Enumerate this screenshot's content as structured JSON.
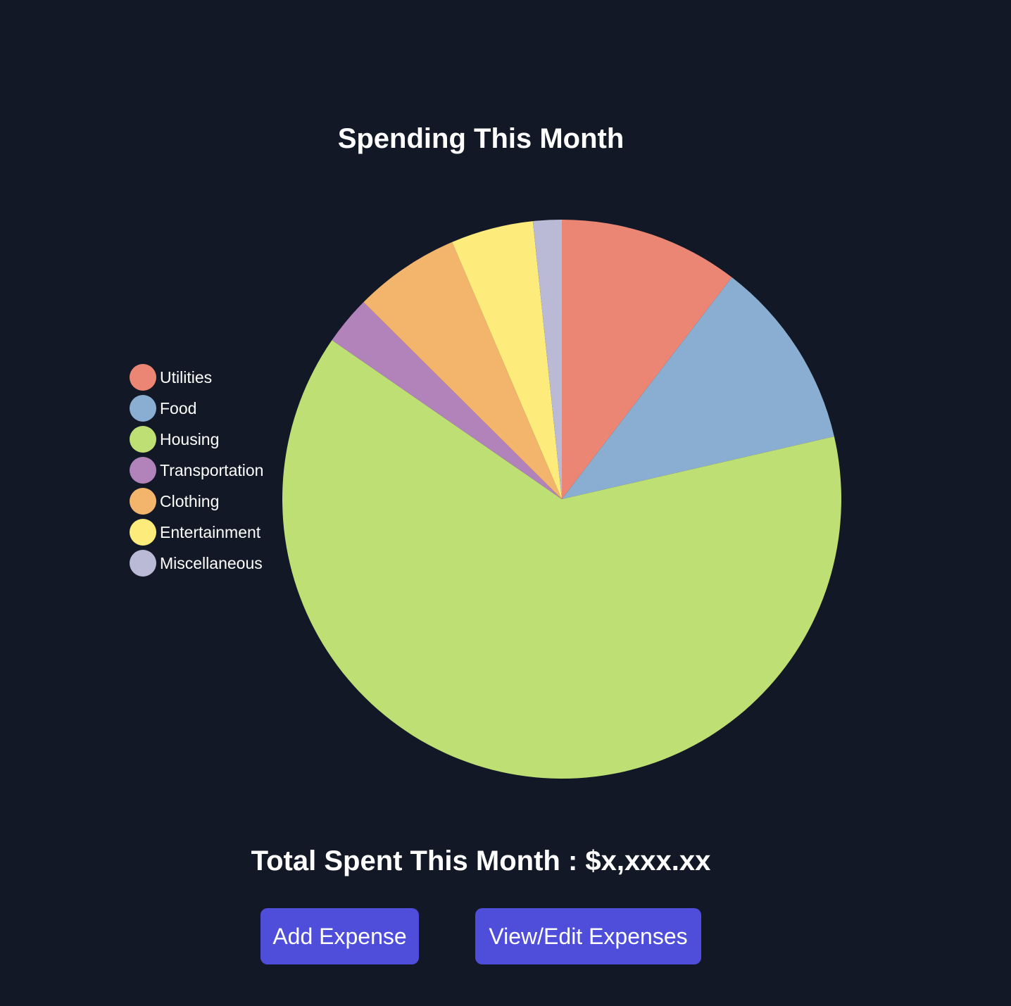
{
  "chart_data": {
    "type": "pie",
    "title": "Spending This Month",
    "legend_position": "left",
    "slices": [
      {
        "label": "Utilities",
        "value": 10.7,
        "color": "#ec8674"
      },
      {
        "label": "Food",
        "value": 11.3,
        "color": "#8aaed1"
      },
      {
        "label": "Housing",
        "value": 65.0,
        "color": "#bedf73"
      },
      {
        "label": "Transportation",
        "value": 2.9,
        "color": "#b283bb"
      },
      {
        "label": "Clothing",
        "value": 6.3,
        "color": "#f3b56b"
      },
      {
        "label": "Entertainment",
        "value": 4.9,
        "color": "#fdec7b"
      },
      {
        "label": "Miscellaneous",
        "value": 1.7,
        "color": "#babad7"
      }
    ]
  },
  "summary": {
    "total_text": "Total Spent This Month : $x,xxx.xx"
  },
  "actions": {
    "add_label": "Add Expense",
    "view_label": "View/Edit Expenses"
  },
  "colors": {
    "background": "#131826",
    "button": "#4f4edb"
  }
}
